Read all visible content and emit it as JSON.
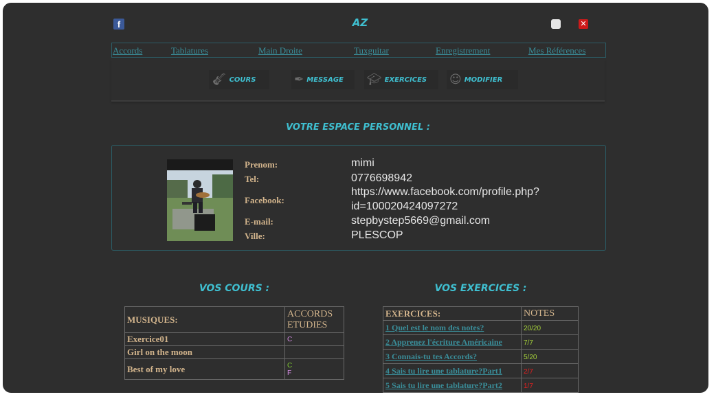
{
  "header": {
    "title": "AZ",
    "facebook_icon": "f",
    "close_icon": "✕"
  },
  "nav": [
    "Accords",
    "Tablatures",
    "Main Droite",
    "Tuxguitar",
    "Enregistrement",
    "Mes Références"
  ],
  "toolbar": [
    {
      "label": "COURS",
      "icon": "guitar-icon"
    },
    {
      "label": "MESSAGE",
      "icon": "pen-icon"
    },
    {
      "label": "EXERCICES",
      "icon": "graduation-cap-icon"
    },
    {
      "label": "MODIFIER",
      "icon": "user-edit-icon"
    }
  ],
  "profile": {
    "title": "VOTRE ESPACE PERSONNEL :",
    "labels": {
      "prenom": "Prenom:",
      "tel": "Tel:",
      "facebook": "Facebook:",
      "email": "E-mail:",
      "ville": "Ville:"
    },
    "values": {
      "prenom": "mimi",
      "tel": "0776698942",
      "facebook_line1": "https://www.facebook.com/profile.php?",
      "facebook_line2": "id=100020424097272",
      "email": "stepbystep5669@gmail.com",
      "ville": "PLESCOP"
    }
  },
  "cours": {
    "title": "VOS COURS :",
    "header": {
      "col1": "MUSIQUES:",
      "col2_line1": "ACCORDS",
      "col2_line2": "ETUDIES"
    },
    "rows": [
      {
        "name": "Exercice01",
        "chords": [
          "C"
        ],
        "colors": [
          "#d28be0"
        ]
      },
      {
        "name": "Girl on the moon",
        "chords": [],
        "colors": []
      },
      {
        "name": "Best of my love",
        "chords": [
          "C",
          "F"
        ],
        "colors": [
          "#7ec832",
          "#d28be0"
        ]
      }
    ]
  },
  "exercices": {
    "title": "VOS EXERCICES :",
    "header": {
      "col1": "EXERCICES:",
      "col2": "NOTES"
    },
    "rows": [
      {
        "name": "1 Quel est le nom des notes?",
        "note": "20/20",
        "color": "#a6d23a"
      },
      {
        "name": "2 Apprenez l'écriture Américaine",
        "note": "7/7",
        "color": "#a6d23a"
      },
      {
        "name": "3 Connais-tu tes Accords?",
        "note": "5/20",
        "color": "#a6d23a"
      },
      {
        "name": "4 Sais tu lire une tablature?Part1",
        "note": "2/7",
        "color": "#e02020"
      },
      {
        "name": "5 Sais tu lire une tablature?Part2",
        "note": "1/7",
        "color": "#e02020"
      }
    ]
  }
}
